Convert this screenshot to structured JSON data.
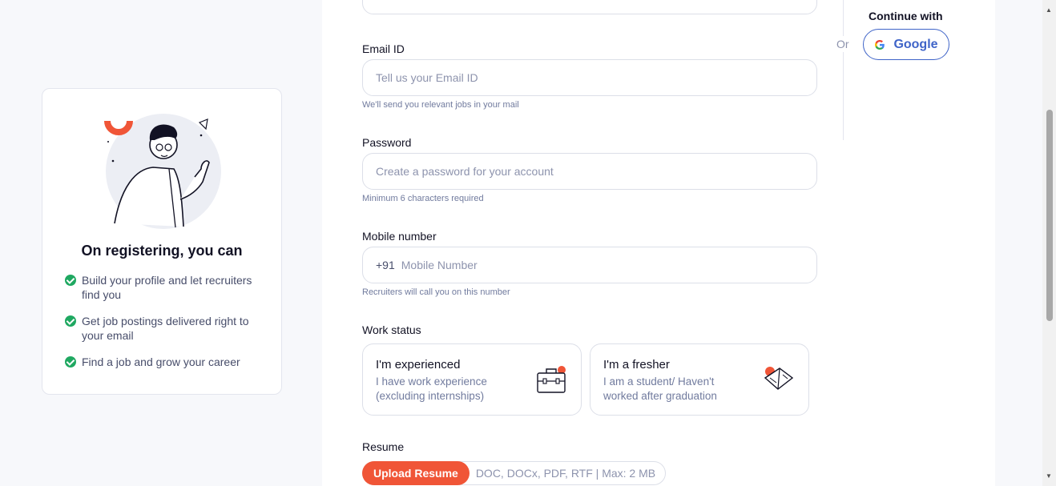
{
  "side": {
    "title": "On registering, you can",
    "benefits": [
      "Build your profile and let recruiters find you",
      "Get job postings delivered right to your email",
      "Find a job and grow your career"
    ]
  },
  "form": {
    "email": {
      "label": "Email ID",
      "placeholder": "Tell us your Email ID",
      "hint": "We'll send you relevant jobs in your mail"
    },
    "password": {
      "label": "Password",
      "placeholder": "Create a password for your account",
      "hint": "Minimum 6 characters required"
    },
    "mobile": {
      "label": "Mobile number",
      "prefix": "+91",
      "placeholder": "Mobile Number",
      "hint": "Recruiters will call you on this number"
    },
    "work_status": {
      "label": "Work status",
      "options": [
        {
          "title": "I'm experienced",
          "desc": "I have work experience (excluding internships)",
          "icon": "briefcase-icon"
        },
        {
          "title": "I'm a fresher",
          "desc": "I am a student/ Haven't worked after graduation",
          "icon": "book-icon"
        }
      ]
    },
    "resume": {
      "label": "Resume",
      "button": "Upload Resume",
      "hint": "DOC, DOCx, PDF, RTF | Max: 2 MB"
    }
  },
  "social": {
    "or": "Or",
    "continue_with": "Continue with",
    "google": "Google"
  },
  "colors": {
    "accent": "#f05537",
    "google_blue": "#3f64c8",
    "check_green": "#1fa861"
  }
}
